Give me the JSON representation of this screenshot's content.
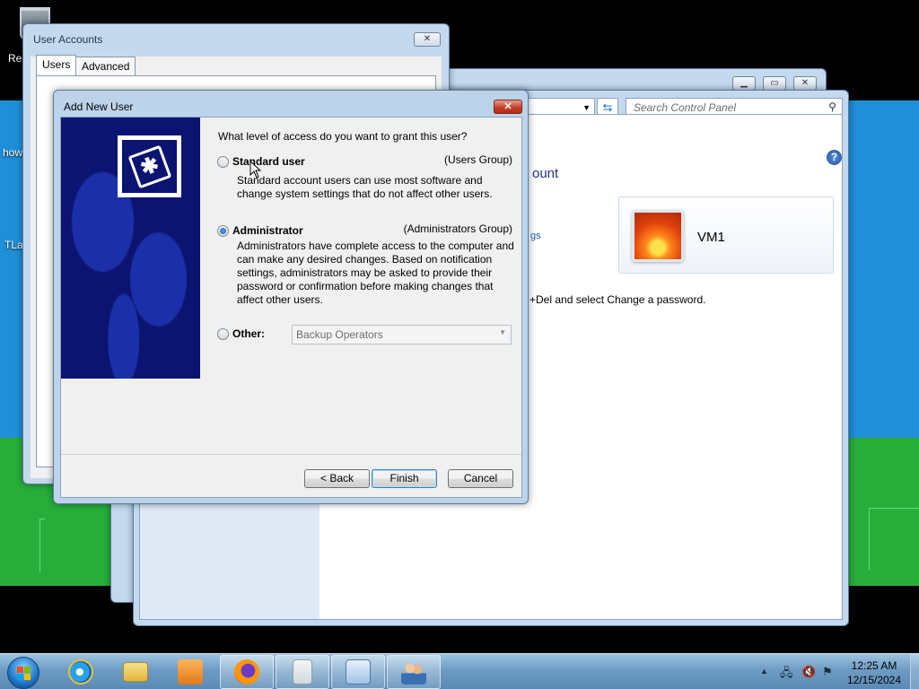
{
  "desktop": {
    "icons": [
      {
        "label": "Rec"
      },
      {
        "label": "how"
      },
      {
        "label": "TLa"
      }
    ]
  },
  "control_panel": {
    "search_placeholder": "Search Control Panel",
    "heading_partial": "ount",
    "link_partial": "gs",
    "info_text": "+Del and select Change a password.",
    "user_card_name": "VM1",
    "help_glyph": "?"
  },
  "user_accounts": {
    "title": "User Accounts",
    "tabs": [
      {
        "label": "Users",
        "active": true
      },
      {
        "label": "Advanced",
        "active": false
      }
    ]
  },
  "dialog": {
    "title": "Add New User",
    "close_glyph": "✕",
    "prompt": "What level of access do you want to grant this user?",
    "options": [
      {
        "label": "Standard user",
        "group": "(Users Group)",
        "description": "Standard account users can use most software and change system settings that do not affect other users.",
        "checked": false
      },
      {
        "label": "Administrator",
        "group": "(Administrators Group)",
        "description": "Administrators have complete access to the computer and can make any desired changes. Based on notification settings, administrators may be asked to provide their password or confirmation before making changes that affect other users.",
        "checked": true
      },
      {
        "label": "Other:",
        "checked": false
      }
    ],
    "other_select_value": "Backup Operators",
    "buttons": {
      "back": "< Back",
      "finish": "Finish",
      "cancel": "Cancel"
    }
  },
  "taskbar": {
    "clock_time": "12:25 AM",
    "clock_date": "12/15/2024",
    "apps": [
      {
        "name": "Internet Explorer",
        "icon": "ie-icon",
        "open": false
      },
      {
        "name": "Windows Explorer",
        "icon": "folder-icon",
        "open": false
      },
      {
        "name": "Media Player",
        "icon": "media-player-icon",
        "open": false
      },
      {
        "name": "Firefox",
        "icon": "firefox-icon",
        "open": true
      },
      {
        "name": "Document",
        "icon": "document-icon",
        "open": true
      },
      {
        "name": "Control Panel",
        "icon": "control-panel-icon",
        "open": true
      },
      {
        "name": "User Accounts",
        "icon": "users-icon",
        "open": true
      }
    ]
  }
}
